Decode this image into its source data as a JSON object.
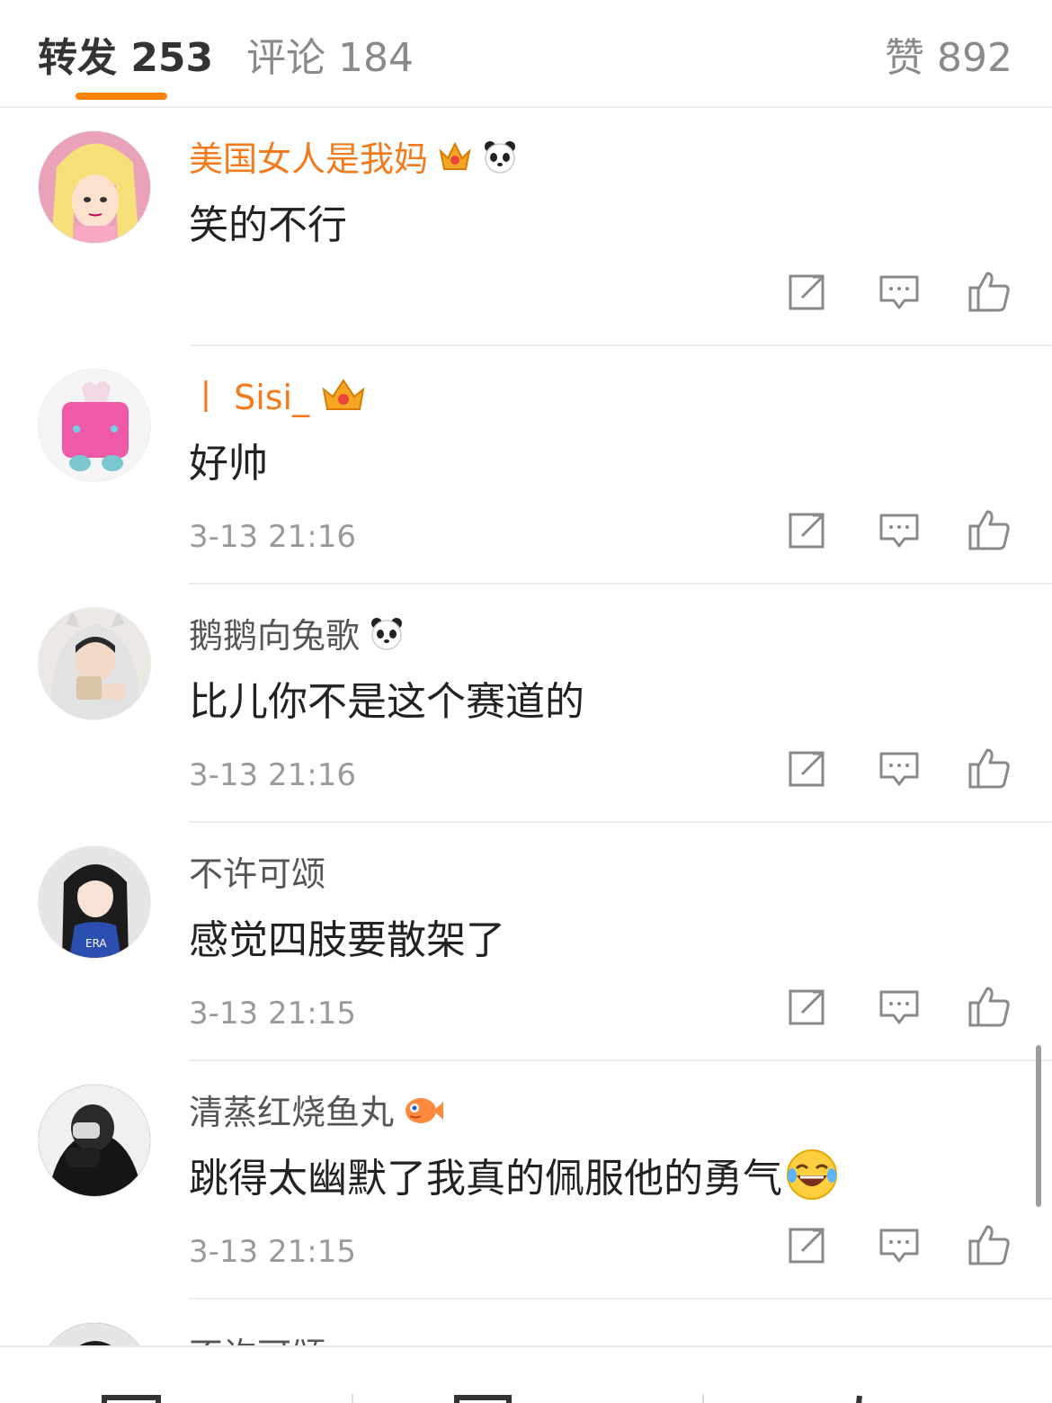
{
  "tabs": {
    "repost": "转发 253",
    "comment": "评论 184",
    "like": "赞 892"
  },
  "comments": [
    {
      "username": "美国女人是我妈",
      "text": "笑的不行",
      "time": "",
      "vip": true,
      "badges": [
        "crown-badge-icon",
        "panda-badge-icon"
      ]
    },
    {
      "username": "丨 Sisi_",
      "text": "好帅",
      "time": "3-13 21:16",
      "vip": true,
      "badges": [
        "crown-badge-icon"
      ]
    },
    {
      "username": "鹅鹅向兔歌",
      "text": "比儿你不是这个赛道的",
      "time": "3-13 21:16",
      "vip": false,
      "badges": [
        "panda-badge-icon"
      ]
    },
    {
      "username": "不许可颂",
      "text": "感觉四肢要散架了",
      "time": "3-13 21:15",
      "vip": false,
      "badges": []
    },
    {
      "username": "清蒸红烧鱼丸",
      "text": "跳得太幽默了我真的佩服他的勇气",
      "time": "3-13 21:15",
      "vip": false,
      "badges": [
        "fish-badge-icon"
      ],
      "trailing_emoji": "laughing-crying-emoji-icon"
    }
  ],
  "partial_comment": {
    "username": "不许可颂"
  },
  "colors": {
    "accent": "#ff8200",
    "vip_name": "#f37b1d",
    "normal_name": "#555555",
    "timestamp": "#9a9a9a",
    "divider": "#ececec"
  },
  "icons": {
    "actions": [
      "forward-icon",
      "reply-icon",
      "thumbs-up-icon"
    ]
  }
}
